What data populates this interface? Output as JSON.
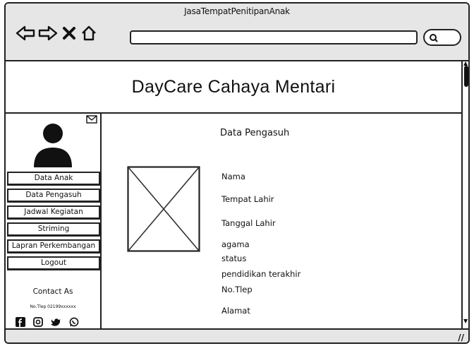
{
  "window": {
    "title": "JasaTempatPenitipanAnak"
  },
  "browser": {
    "icons": [
      "back-arrow-icon",
      "forward-arrow-icon",
      "close-x-icon",
      "home-icon"
    ],
    "url_value": "",
    "search_icon": "search-icon"
  },
  "header": {
    "title": "DayCare Cahaya Mentari"
  },
  "sidebar": {
    "avatar_icon": "user-avatar-icon",
    "mail_icon": "mail-icon",
    "items": [
      {
        "label": "Data Anak"
      },
      {
        "label": "Data Pengasuh"
      },
      {
        "label": "Jadwal Kegiatan"
      },
      {
        "label": "Striming"
      },
      {
        "label": "Lapran Perkembangan"
      },
      {
        "label": "Logout"
      }
    ],
    "contact_label": "Contact As",
    "phone": "No.Tlep 02199xxxxxx",
    "socials": [
      "facebook-icon",
      "instagram-icon",
      "twitter-icon",
      "whatsapp-icon"
    ]
  },
  "main": {
    "title": "Data Pengasuh",
    "photo_placeholder": "image-placeholder",
    "fields": [
      "Nama",
      "Tempat Lahir",
      "Tanggal Lahir",
      "agama",
      "status",
      "pendidikan terakhir",
      "No.Tlep",
      "Alamat"
    ]
  }
}
